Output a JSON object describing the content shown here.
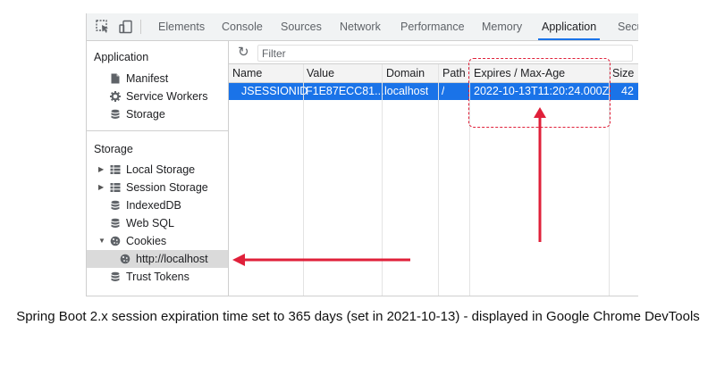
{
  "toolbar": {
    "tabs": [
      {
        "label": "Elements"
      },
      {
        "label": "Console"
      },
      {
        "label": "Sources"
      },
      {
        "label": "Network"
      },
      {
        "label": "Performance"
      },
      {
        "label": "Memory"
      },
      {
        "label": "Application",
        "active": true
      },
      {
        "label": "Secu"
      }
    ]
  },
  "sidebar": {
    "app_section": {
      "heading": "Application",
      "items": [
        {
          "label": "Manifest",
          "icon": "document-icon"
        },
        {
          "label": "Service Workers",
          "icon": "gear-icon"
        },
        {
          "label": "Storage",
          "icon": "database-icon"
        }
      ]
    },
    "storage_section": {
      "heading": "Storage",
      "items": [
        {
          "label": "Local Storage",
          "icon": "grid-icon",
          "expandable": true
        },
        {
          "label": "Session Storage",
          "icon": "grid-icon",
          "expandable": true
        },
        {
          "label": "IndexedDB",
          "icon": "database-icon"
        },
        {
          "label": "Web SQL",
          "icon": "database-icon"
        },
        {
          "label": "Cookies",
          "icon": "cookie-icon",
          "expanded": true
        },
        {
          "label": "http://localhost",
          "icon": "cookie-icon",
          "selected": true
        },
        {
          "label": "Trust Tokens",
          "icon": "database-icon"
        }
      ]
    }
  },
  "filter": {
    "placeholder": "Filter"
  },
  "table": {
    "headers": [
      "Name",
      "Value",
      "Domain",
      "Path",
      "Expires / Max-Age",
      "Size"
    ],
    "rows": [
      [
        "JSESSIONID",
        "F1E87ECC81...",
        "localhost",
        "/",
        "2022-10-13T11:20:24.000Z",
        "42"
      ]
    ]
  },
  "colors": {
    "accent": "#1a73e8",
    "annotation": "#e0203a",
    "selection": "#dadada"
  },
  "caption": "Spring Boot 2.x session expiration time set to 365 days (set in 2021-10-13) - displayed in Google Chrome DevTools"
}
